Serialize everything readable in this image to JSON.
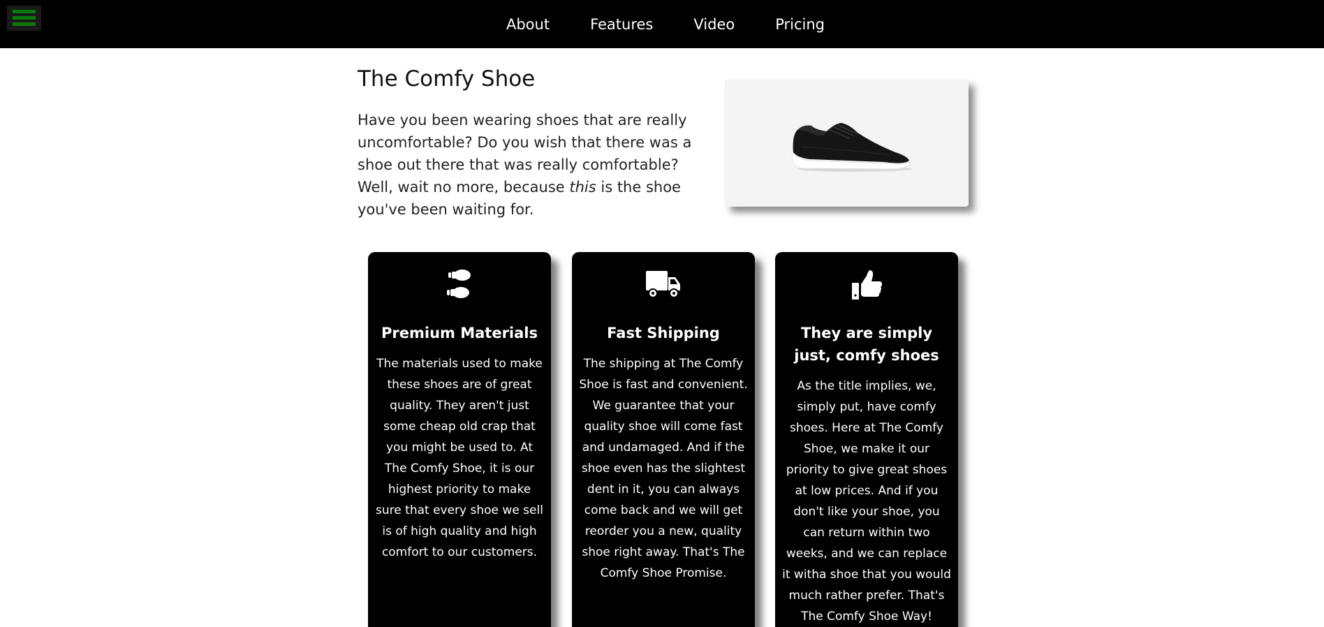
{
  "nav": {
    "menu_icon": "hamburger-menu-icon",
    "accent_color": "#0a7a0a",
    "links": [
      "About",
      "Features",
      "Video",
      "Pricing"
    ]
  },
  "hero": {
    "title": "The Comfy Shoe",
    "text_before": "Have you been wearing shoes that are really uncomfortable? Do you wish that there was a shoe out there that was really comfortable? Well, wait no more, because ",
    "text_emphasis": "this",
    "text_after": " is the shoe you've been waiting for.",
    "image_icon": "black-sneaker-image"
  },
  "features": [
    {
      "icon": "shoe-prints-icon",
      "title": "Premium Materials",
      "text": "The materials used to make these shoes are of great quality. They aren't just some cheap old crap that you might be used to. At The Comfy Shoe, it is our highest priority to make sure that every shoe we sell is of high quality and high comfort to our customers."
    },
    {
      "icon": "truck-icon",
      "title": "Fast Shipping",
      "text": "The shipping at The Comfy Shoe is fast and convenient. We guarantee that your quality shoe will come fast and undamaged. And if the shoe even has the slightest dent in it, you can always come back and we will get reorder you a new, quality shoe right away. That's The Comfy Shoe Promise."
    },
    {
      "icon": "thumbs-up-icon",
      "title": "They are simply just, comfy shoes",
      "text": "As the title implies, we, simply put, have comfy shoes. Here at The Comfy Shoe, we make it our priority to give great shoes at low prices. And if you don't like your shoe, you can return within two weeks, and we can replace it witha shoe that you would much rather prefer. That's The Comfy Shoe Way!"
    }
  ]
}
